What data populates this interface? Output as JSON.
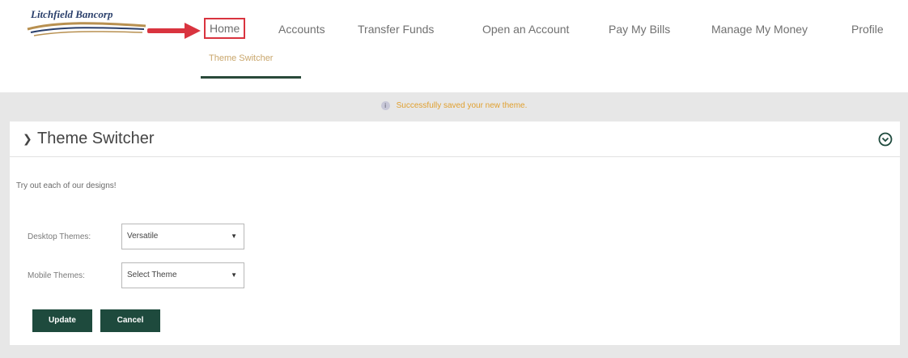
{
  "brand": {
    "logo_text": "Litchfield Bancorp"
  },
  "nav": {
    "items": [
      {
        "label": "Home"
      },
      {
        "label": "Accounts"
      },
      {
        "label": "Transfer Funds"
      },
      {
        "label": "Open an Account"
      },
      {
        "label": "Pay My Bills"
      },
      {
        "label": "Manage My Money"
      },
      {
        "label": "Profile"
      }
    ],
    "active": "Home"
  },
  "subnav": {
    "label": "Theme Switcher"
  },
  "notice": {
    "text": "Successfully saved your new theme."
  },
  "panel": {
    "title": "Theme Switcher",
    "intro": "Try out each of our designs!",
    "desktop": {
      "label": "Desktop Themes:",
      "value": "Versatile"
    },
    "mobile": {
      "label": "Mobile Themes:",
      "value": "Select Theme"
    },
    "update_label": "Update",
    "cancel_label": "Cancel"
  },
  "colors": {
    "accent": "#1e4a3d",
    "highlight": "#d9343f",
    "notice": "#e0a030",
    "subnav": "#c9a66b"
  },
  "icons": {
    "arrow": "arrow-right-icon",
    "panel_toggle": "chevron-down-icon",
    "collapse": "circle-chevron-down-icon",
    "notice": "info-icon"
  }
}
